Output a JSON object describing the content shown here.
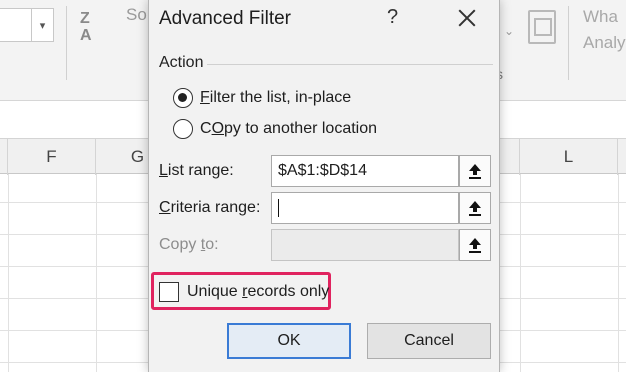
{
  "excel": {
    "ribbon_sort_text": "So",
    "ribbon_sort_icon_top": "Z",
    "ribbon_sort_icon_bottom": "A",
    "ribbon_group_suffix": "s",
    "ribbon_whatif_line1": "Wha",
    "ribbon_whatif_line2": "Analy",
    "columns": [
      "F",
      "G",
      "L"
    ]
  },
  "dialog": {
    "title": "Advanced Filter",
    "help_label": "?",
    "action_group_label": "Action",
    "radio_options": [
      {
        "mnemonic": "F",
        "rest": "ilter the list, in-place",
        "checked": true
      },
      {
        "mnemonic": "O",
        "rest": "py to another location",
        "prefix": "C",
        "checked": false
      }
    ],
    "fields": {
      "list_range": {
        "mnemonic": "L",
        "rest": "ist range:",
        "value": "$A$1:$D$14"
      },
      "criteria_range": {
        "mnemonic": "C",
        "rest": "riteria range:",
        "value": ""
      },
      "copy_to": {
        "prefix": "Copy ",
        "mnemonic": "t",
        "rest": "o:",
        "value": "",
        "disabled": true
      }
    },
    "unique_checkbox": {
      "prefix": "Unique ",
      "mnemonic": "r",
      "rest": "ecords only",
      "checked": false
    },
    "ok_label": "OK",
    "cancel_label": "Cancel",
    "highlight_color": "#e0235f",
    "icons": [
      "close-icon",
      "collapse-dialog-icon"
    ]
  }
}
